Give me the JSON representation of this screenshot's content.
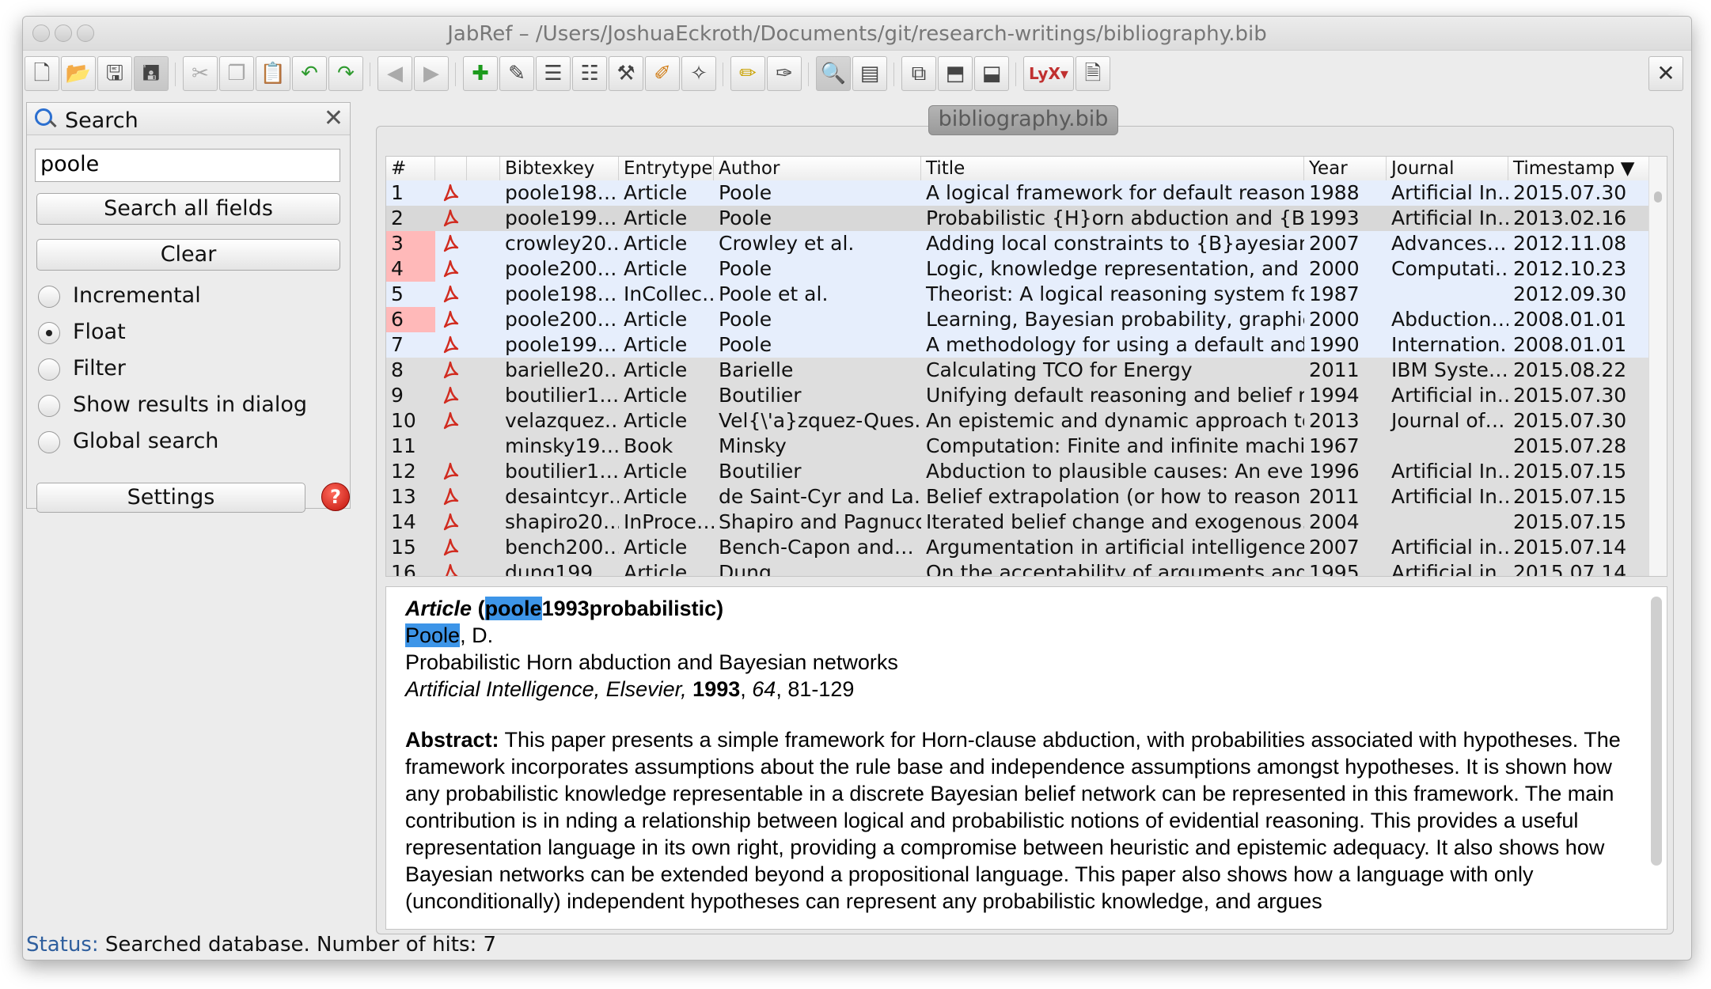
{
  "window": {
    "title": "JabRef – /Users/JoshuaEckroth/Documents/git/research-writings/bibliography.bib"
  },
  "toolbar": {
    "buttons": [
      "new-database-icon",
      "open-database-icon",
      "save-icon",
      "save-all-icon",
      "cut-icon",
      "copy-icon",
      "paste-icon",
      "undo-icon",
      "redo-icon",
      "back-icon",
      "forward-icon",
      "new-entry-icon",
      "edit-entry-icon",
      "edit-preamble-icon",
      "edit-strings-icon",
      "cleanup-icon",
      "push-icon",
      "mark-entries-icon",
      "unmark-icon",
      "search-icon",
      "toggle-groups-icon",
      "window-icon",
      "import-icon",
      "export-icon",
      "lyx-icon",
      "close-icon"
    ],
    "close_label": "✕"
  },
  "search": {
    "title": "Search",
    "close_label": "✕",
    "query": "poole",
    "search_all_label": "Search all fields",
    "clear_label": "Clear",
    "options": [
      {
        "label": "Incremental",
        "selected": false
      },
      {
        "label": "Float",
        "selected": true
      },
      {
        "label": "Filter",
        "selected": false
      },
      {
        "label": "Show results in dialog",
        "selected": false
      },
      {
        "label": "Global search",
        "selected": false
      }
    ],
    "settings_label": "Settings",
    "help_label": "?"
  },
  "tab": {
    "label": "bibliography.bib"
  },
  "table": {
    "headers": [
      "#",
      "",
      "",
      "Bibtexkey",
      "Entrytype",
      "Author",
      "Title",
      "Year",
      "Journal",
      "Timestamp ▼"
    ],
    "rows": [
      {
        "n": "1",
        "pdf": true,
        "key": "poole198…",
        "type": "Article",
        "author": "Poole",
        "title": "A logical framework for default reasoning",
        "year": "1988",
        "journal": "Artificial In…",
        "ts": "2015.07.30",
        "hit": true,
        "numhl": false
      },
      {
        "n": "2",
        "pdf": true,
        "key": "poole199…",
        "type": "Article",
        "author": "Poole",
        "title": "Probabilistic {H}orn abduction and {B}a…",
        "year": "1993",
        "journal": "Artificial In…",
        "ts": "2013.02.16",
        "hit": true,
        "numhl": false,
        "selected": true
      },
      {
        "n": "3",
        "pdf": true,
        "key": "crowley20…",
        "type": "Article",
        "author": "Crowley et al.",
        "title": "Adding local constraints to {B}ayesian n…",
        "year": "2007",
        "journal": "Advances…",
        "ts": "2012.11.08",
        "hit": true,
        "numhl": true
      },
      {
        "n": "4",
        "pdf": true,
        "key": "poole200…",
        "type": "Article",
        "author": "Poole",
        "title": "Logic, knowledge representation, and B…",
        "year": "2000",
        "journal": "Computati…",
        "ts": "2012.10.23",
        "hit": true,
        "numhl": true
      },
      {
        "n": "5",
        "pdf": true,
        "key": "poole198…",
        "type": "InCollec…",
        "author": "Poole et al.",
        "title": "Theorist: A logical reasoning system for…",
        "year": "1987",
        "journal": "",
        "ts": "2012.09.30",
        "hit": true,
        "numhl": false
      },
      {
        "n": "6",
        "pdf": true,
        "key": "poole200…",
        "type": "Article",
        "author": "Poole",
        "title": "Learning, Bayesian probability, graphic…",
        "year": "2000",
        "journal": "Abduction…",
        "ts": "2008.01.01",
        "hit": true,
        "numhl": true
      },
      {
        "n": "7",
        "pdf": true,
        "key": "poole199…",
        "type": "Article",
        "author": "Poole",
        "title": "A methodology for using a default and…",
        "year": "1990",
        "journal": "Internation…",
        "ts": "2008.01.01",
        "hit": true,
        "numhl": false
      },
      {
        "n": "8",
        "pdf": true,
        "key": "barielle20…",
        "type": "Article",
        "author": "Barielle",
        "title": "Calculating TCO for Energy",
        "year": "2011",
        "journal": "IBM Syste…",
        "ts": "2015.08.22",
        "hit": false
      },
      {
        "n": "9",
        "pdf": true,
        "key": "boutilier1…",
        "type": "Article",
        "author": "Boutilier",
        "title": "Unifying default reasoning and belief re…",
        "year": "1994",
        "journal": "Artificial in…",
        "ts": "2015.07.30",
        "hit": false
      },
      {
        "n": "10",
        "pdf": true,
        "key": "velazquez…",
        "type": "Article",
        "author": "Vel{\\'a}zquez-Ques…",
        "title": "An epistemic and dynamic approach to…",
        "year": "2013",
        "journal": "Journal of…",
        "ts": "2015.07.30",
        "hit": false
      },
      {
        "n": "11",
        "pdf": false,
        "key": "minsky19…",
        "type": "Book",
        "author": "Minsky",
        "title": "Computation: Finite and infinite machines",
        "year": "1967",
        "journal": "",
        "ts": "2015.07.28",
        "hit": false
      },
      {
        "n": "12",
        "pdf": true,
        "key": "boutilier1…",
        "type": "Article",
        "author": "Boutilier",
        "title": "Abduction to plausible causes: An even…",
        "year": "1996",
        "journal": "Artificial In…",
        "ts": "2015.07.15",
        "hit": false
      },
      {
        "n": "13",
        "pdf": true,
        "key": "desaintcyr…",
        "type": "Article",
        "author": "de Saint-Cyr and La…",
        "title": "Belief extrapolation (or how to reason a…",
        "year": "2011",
        "journal": "Artificial In…",
        "ts": "2015.07.15",
        "hit": false
      },
      {
        "n": "14",
        "pdf": true,
        "key": "shapiro20…",
        "type": "InProce…",
        "author": "Shapiro and Pagnucco",
        "title": "Iterated belief change and exogenous…",
        "year": "2004",
        "journal": "",
        "ts": "2015.07.15",
        "hit": false
      },
      {
        "n": "15",
        "pdf": true,
        "key": "bench200…",
        "type": "Article",
        "author": "Bench-Capon and…",
        "title": "Argumentation in artificial intelligence",
        "year": "2007",
        "journal": "Artificial in…",
        "ts": "2015.07.14",
        "hit": false
      },
      {
        "n": "16",
        "pdf": true,
        "key": "dung199…",
        "type": "Article",
        "author": "Dung",
        "title": "On the acceptability of arguments and i…",
        "year": "1995",
        "journal": "Artificial in…",
        "ts": "2015.07.14",
        "hit": false
      }
    ]
  },
  "preview": {
    "type": "Article",
    "key_open": "(",
    "key_hit": "poole",
    "key_rest": "1993probabilistic)",
    "author_hit": "Poole",
    "author_rest": ", D.",
    "title": "Probabilistic Horn abduction and Bayesian networks",
    "journal": "Artificial Intelligence, Elsevier,",
    "year": "1993",
    "volume": "64",
    "pages": ", 81-129",
    "abstract_label": "Abstract:",
    "abstract": "This paper presents a simple framework for Horn-clause abduction, with probabilities associated with hypotheses. The framework incorporates assumptions about the rule base and independence assumptions amongst hypotheses. It is shown how any probabilistic knowledge representable in a discrete Bayesian belief network can be represented in this framework. The main contribution is in nding a relationship between logical and probabilistic notions of evidential reasoning. This provides a useful representation language in its own right, providing a compromise between heuristic and epistemic adequacy. It also shows how Bayesian networks can be extended beyond a propositional language. This paper also shows how a language with only (unconditionally) independent hypotheses can represent any probabilistic knowledge, and argues"
  },
  "status": {
    "label": "Status:",
    "text": "Searched database. Number of hits: 7"
  },
  "colors": {
    "hit_row": "#e6eefc",
    "selected_row": "#d8d8d8",
    "nonhit_row": "#dedede",
    "num_hit": "#ffb9b9",
    "highlight": "#3d95e8"
  }
}
